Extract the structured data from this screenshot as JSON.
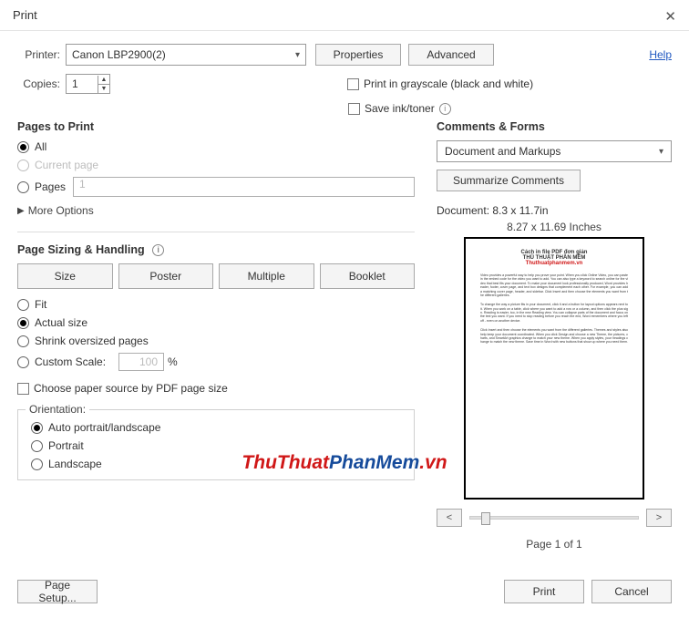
{
  "title": "Print",
  "printer": {
    "label": "Printer:",
    "value": "Canon LBP2900(2)",
    "properties_btn": "Properties",
    "advanced_btn": "Advanced"
  },
  "help": "Help",
  "copies": {
    "label": "Copies:",
    "value": "1"
  },
  "grayscale_chk": "Print in grayscale (black and white)",
  "saveink_chk": "Save ink/toner",
  "pages_to_print": {
    "title": "Pages to Print",
    "all": "All",
    "current": "Current page",
    "pages": "Pages",
    "pages_value": "1",
    "more": "More Options"
  },
  "sizing": {
    "title": "Page Sizing & Handling",
    "size": "Size",
    "poster": "Poster",
    "multiple": "Multiple",
    "booklet": "Booklet",
    "fit": "Fit",
    "actual": "Actual size",
    "shrink": "Shrink oversized pages",
    "custom": "Custom Scale:",
    "custom_val": "100",
    "pct": "%",
    "paper_source": "Choose paper source by PDF page size"
  },
  "orientation": {
    "legend": "Orientation:",
    "auto": "Auto portrait/landscape",
    "portrait": "Portrait",
    "landscape": "Landscape"
  },
  "comments_forms": {
    "title": "Comments & Forms",
    "value": "Document and Markups",
    "summarize": "Summarize Comments"
  },
  "doc_size": "Document: 8.3 x 11.7in",
  "preview_dim": "8.27 x 11.69 Inches",
  "preview_doc": {
    "line1": "Cách in file PDF đơn giản",
    "line2": "THỦ THUẬT PHẦN MỀM",
    "link": "Thuthuatphanmem.vn"
  },
  "nav": {
    "prev": "<",
    "next": ">"
  },
  "page_counter": "Page 1 of 1",
  "footer": {
    "page_setup": "Page Setup...",
    "print": "Print",
    "cancel": "Cancel"
  },
  "watermark": {
    "a": "ThuThuat",
    "b": "PhanMem",
    "c": ".vn"
  }
}
